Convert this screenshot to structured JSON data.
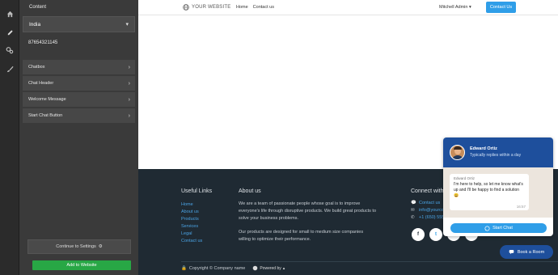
{
  "panel": {
    "title": "Content",
    "country": "India",
    "phone": "87654321145",
    "rows": [
      {
        "label": "Chatbox"
      },
      {
        "label": "Chat Header"
      },
      {
        "label": "Welcome Message"
      },
      {
        "label": "Start Chat Button"
      }
    ],
    "continue_label": "Continue to Settings",
    "add_label": "Add to Website"
  },
  "site": {
    "logo_text": "YOUR WEBSITE",
    "nav": [
      "Home",
      "Contact us"
    ],
    "user": "Mitchell Admin",
    "contact_btn": "Contact Us"
  },
  "footer": {
    "useful_links_title": "Useful Links",
    "links": [
      "Home",
      "About us",
      "Products",
      "Services",
      "Legal",
      "Contact us"
    ],
    "about_title": "About us",
    "about_p1": "We are a team of passionate people whose goal is to improve everyone's life through disruptive products. We build great products to solve your business problems.",
    "about_p2": "Our products are designed for small to medium size companies willing to optimize their performance.",
    "connect_title": "Connect with us",
    "connect": [
      {
        "icon": "comment-icon",
        "text": "Contact us"
      },
      {
        "icon": "envelope-icon",
        "text": "info@yourcompany.example.com"
      },
      {
        "icon": "phone-icon",
        "text": "+1 (650) 555-0111"
      }
    ],
    "socials": [
      "f",
      "t",
      "in",
      "⌂"
    ],
    "copyright": "Copyright © Company name",
    "powered": "Powered by"
  },
  "chat": {
    "agent_name": "Edward Ortiz",
    "agent_sub": "Typically replies within a day",
    "bubble_name": "Edward Ortiz",
    "bubble_text": "I'm here to help, so let me know what's up and I'll be happy to find a solution 😀",
    "bubble_time": "16:57",
    "start_label": "Start Chat"
  },
  "book": {
    "label": "Book a Room"
  },
  "colors": {
    "accent": "#2f9ee8",
    "brand": "#1e4f9c",
    "add": "#28a745",
    "footer": "#1f2a33"
  }
}
